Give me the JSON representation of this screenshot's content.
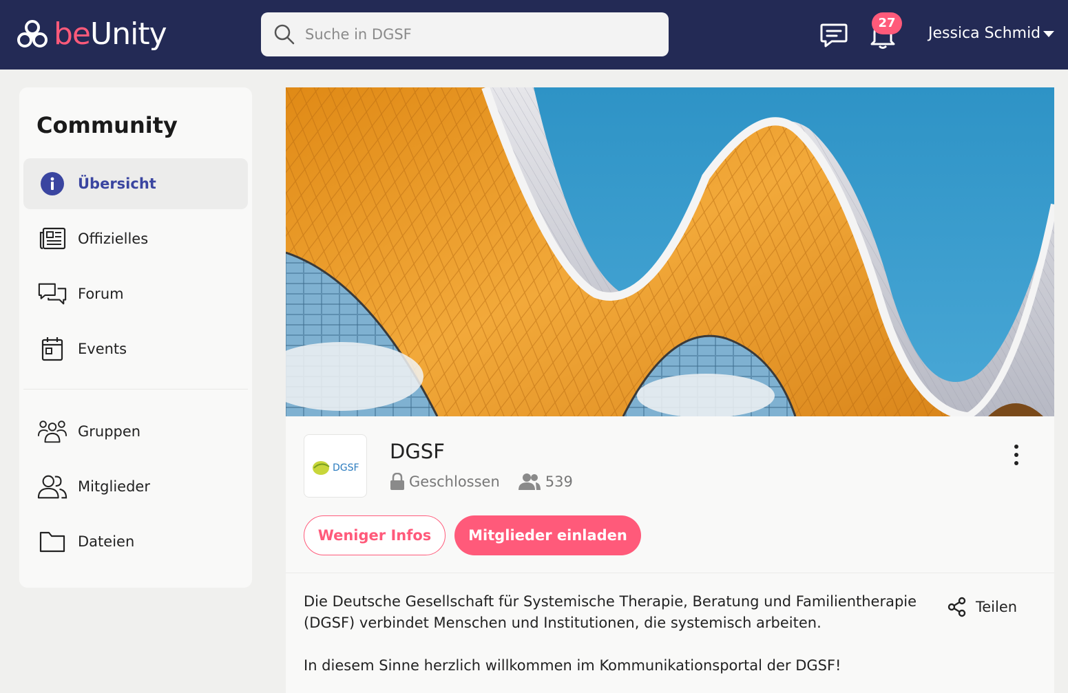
{
  "header": {
    "logo_be": "be",
    "logo_unity": "Unity",
    "search_placeholder": "Suche in DGSF",
    "notification_count": "27",
    "user_name": "Jessica Schmid"
  },
  "sidebar": {
    "title": "Community",
    "items": [
      {
        "label": "Übersicht",
        "icon": "info-icon",
        "active": true
      },
      {
        "label": "Offizielles",
        "icon": "newspaper-icon"
      },
      {
        "label": "Forum",
        "icon": "chat-bubbles-icon"
      },
      {
        "label": "Events",
        "icon": "calendar-icon"
      },
      {
        "label": "Gruppen",
        "icon": "groups-icon"
      },
      {
        "label": "Mitglieder",
        "icon": "members-icon"
      },
      {
        "label": "Dateien",
        "icon": "folder-icon"
      }
    ]
  },
  "group": {
    "logo_text": "DGSF",
    "name": "DGSF",
    "privacy": "Geschlossen",
    "member_count": "539",
    "less_info_label": "Weniger Infos",
    "invite_label": "Mitglieder einladen",
    "description": [
      "Die Deutsche Gesellschaft für Systemische Therapie, Beratung und Familientherapie (DGSF) verbindet Menschen und Institutionen, die systemisch arbeiten.",
      "In diesem Sinne herzlich willkommen im Kommunikationsportal der DGSF!"
    ],
    "share_label": "Teilen"
  },
  "colors": {
    "header_bg": "#232a55",
    "accent": "#ff5a7a",
    "active_nav": "#3a45a0"
  }
}
